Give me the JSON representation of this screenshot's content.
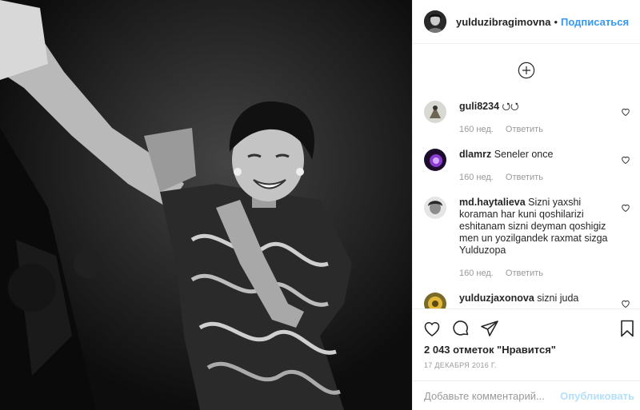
{
  "post": {
    "username": "yulduzibragimovna",
    "separator": "•",
    "follow_label": "Подписаться"
  },
  "comments": [
    {
      "user": "guli8234",
      "text": "⭯⭯",
      "age": "160 нед.",
      "reply_label": "Ответить"
    },
    {
      "user": "dlamrz",
      "text": "Seneler once",
      "age": "160 нед.",
      "reply_label": "Ответить"
    },
    {
      "user": "md.haytalieva",
      "text": "Sizni yaxshi koraman har kuni qoshilarizi eshitanam sizni deyman qoshigiz men un yozilgandek raxmat sizga Yulduzopa",
      "age": "160 нед.",
      "reply_label": "Ответить"
    },
    {
      "user": "yulduzjaxonova",
      "text": "sizni juda",
      "age": "",
      "reply_label": ""
    }
  ],
  "stats": {
    "likes": "2 043 отметок \"Нравится\"",
    "date": "17 ДЕКАБРЯ 2016 Г."
  },
  "add_comment": {
    "placeholder": "Добавьте комментарий...",
    "publish_label": "Опубликовать"
  },
  "colors": {
    "accent": "#3897f0",
    "publish_disabled": "#b2dffc",
    "meta": "#999999",
    "divider": "#efefef"
  },
  "icons": [
    "load-more-icon",
    "heart-icon",
    "comment-icon",
    "share-icon",
    "bookmark-icon"
  ]
}
